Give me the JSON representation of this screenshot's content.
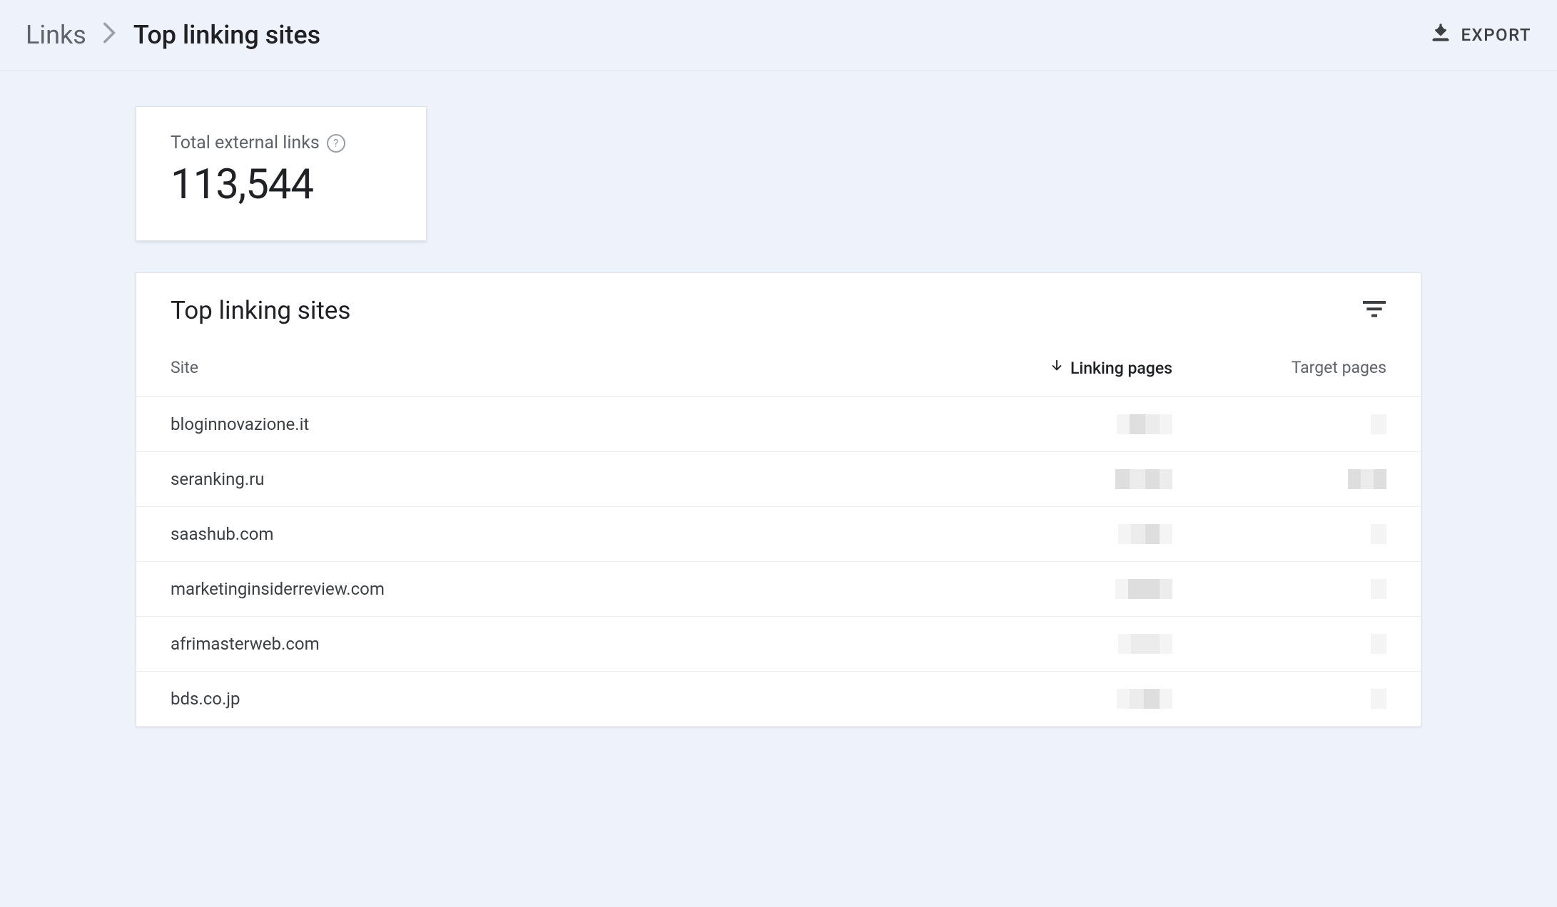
{
  "breadcrumb": {
    "parent": "Links",
    "current": "Top linking sites"
  },
  "export_label": "EXPORT",
  "summary": {
    "label": "Total external links",
    "value": "113,544"
  },
  "table": {
    "title": "Top linking sites",
    "columns": {
      "site": "Site",
      "linking_pages": "Linking pages",
      "target_pages": "Target pages"
    },
    "rows": [
      {
        "site": "bloginnovazione.it"
      },
      {
        "site": "seranking.ru"
      },
      {
        "site": "saashub.com"
      },
      {
        "site": "marketinginsiderreview.com"
      },
      {
        "site": "afrimasterweb.com"
      },
      {
        "site": "bds.co.jp"
      }
    ]
  }
}
